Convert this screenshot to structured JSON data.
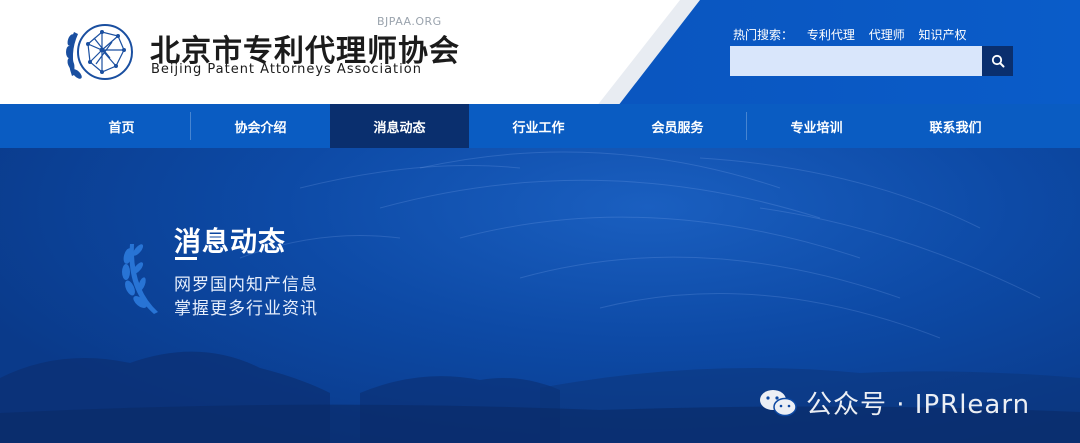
{
  "header": {
    "org_name_cn": "北京市专利代理师协会",
    "org_name_en": "Beijing Patent Attorneys Association",
    "org_abbr": "BJPAA.ORG",
    "hot_search_label": "热门搜索：",
    "hot_search_items": [
      "专利代理",
      "代理师",
      "知识产权"
    ],
    "search_placeholder": ""
  },
  "nav": {
    "items": [
      {
        "label": "首页",
        "active": false
      },
      {
        "label": "协会介绍",
        "active": false
      },
      {
        "label": "消息动态",
        "active": true
      },
      {
        "label": "行业工作",
        "active": false
      },
      {
        "label": "会员服务",
        "active": false
      },
      {
        "label": "专业培训",
        "active": false
      },
      {
        "label": "联系我们",
        "active": false
      }
    ]
  },
  "banner": {
    "title": "消息动态",
    "line1": "网罗国内知产信息",
    "line2": "掌握更多行业资讯"
  },
  "watermark": {
    "text": "公众号 · IPRlearn",
    "icon": "wechat-icon"
  },
  "colors": {
    "nav_bg": "#0a5cc2",
    "nav_active": "#0a2f6e",
    "banner_bg": "#0d4aa6",
    "search_bg": "#d9e6fb"
  }
}
